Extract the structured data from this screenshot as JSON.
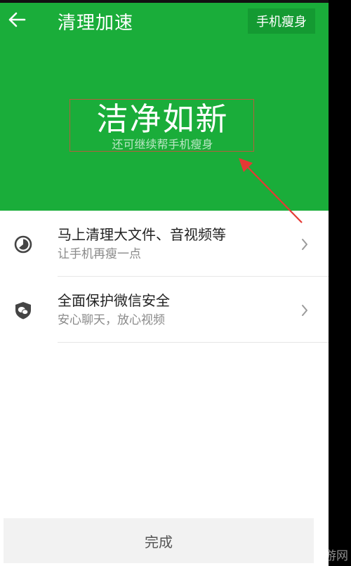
{
  "header": {
    "title": "清理加速",
    "right_button_label": "手机瘦身",
    "hero_title": "洁净如新",
    "hero_subtitle": "还可继续帮手机瘦身"
  },
  "list": {
    "items": [
      {
        "icon": "clock-pie-icon",
        "title": "马上清理大文件、音视频等",
        "subtitle": "让手机再瘦一点"
      },
      {
        "icon": "shield-wechat-icon",
        "title": "全面保护微信安全",
        "subtitle": "安心聊天，放心视频"
      }
    ]
  },
  "footer": {
    "done_label": "完成"
  },
  "watermark": "游网",
  "colors": {
    "brand_green": "#1aad3a",
    "annotation_red": "#e53935"
  }
}
